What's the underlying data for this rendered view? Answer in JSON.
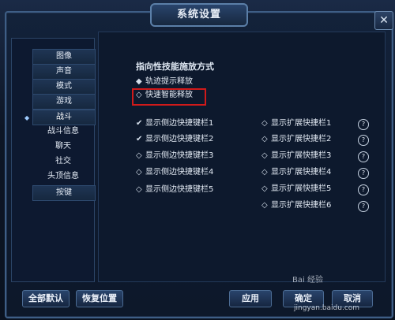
{
  "window": {
    "title": "系统设置",
    "close_glyph": "✕"
  },
  "sidebar": {
    "items": [
      {
        "label": "图像",
        "boxed": true
      },
      {
        "label": "声音",
        "boxed": true
      },
      {
        "label": "模式",
        "boxed": true
      },
      {
        "label": "游戏",
        "boxed": true
      },
      {
        "label": "战斗",
        "boxed": true,
        "active": true
      },
      {
        "label": "战斗信息",
        "boxed": false
      },
      {
        "label": "聊天",
        "boxed": false
      },
      {
        "label": "社交",
        "boxed": false
      },
      {
        "label": "头顶信息",
        "boxed": false
      },
      {
        "label": "按键",
        "boxed": true
      }
    ],
    "active_marker": "◆"
  },
  "skill_release": {
    "title": "指向性技能施放方式",
    "options": [
      {
        "label": "轨迹提示释放",
        "selected": true
      },
      {
        "label": "快速智能释放",
        "selected": false
      }
    ]
  },
  "side_hotbars": [
    {
      "label": "显示侧边快捷键栏1",
      "checked": true
    },
    {
      "label": "显示侧边快捷键栏2",
      "checked": true
    },
    {
      "label": "显示侧边快捷键栏3",
      "checked": false
    },
    {
      "label": "显示侧边快捷键栏4",
      "checked": false
    },
    {
      "label": "显示侧边快捷键栏5",
      "checked": false
    }
  ],
  "ext_hotbars": [
    {
      "label": "显示扩展快捷栏1",
      "checked": false
    },
    {
      "label": "显示扩展快捷栏2",
      "checked": false
    },
    {
      "label": "显示扩展快捷栏3",
      "checked": false
    },
    {
      "label": "显示扩展快捷栏4",
      "checked": false
    },
    {
      "label": "显示扩展快捷栏5",
      "checked": false
    },
    {
      "label": "显示扩展快捷栏6",
      "checked": false
    }
  ],
  "help_glyph": "?",
  "buttons": {
    "reset_all": "全部默认",
    "restore_position": "恢复位置",
    "apply": "应用",
    "confirm": "确定",
    "cancel": "取消"
  },
  "watermark": {
    "brand": "Bai 经验",
    "url": "jingyan.baidu.com"
  },
  "colors": {
    "highlight": "#d01a1a",
    "accent": "#5b7fa8"
  }
}
